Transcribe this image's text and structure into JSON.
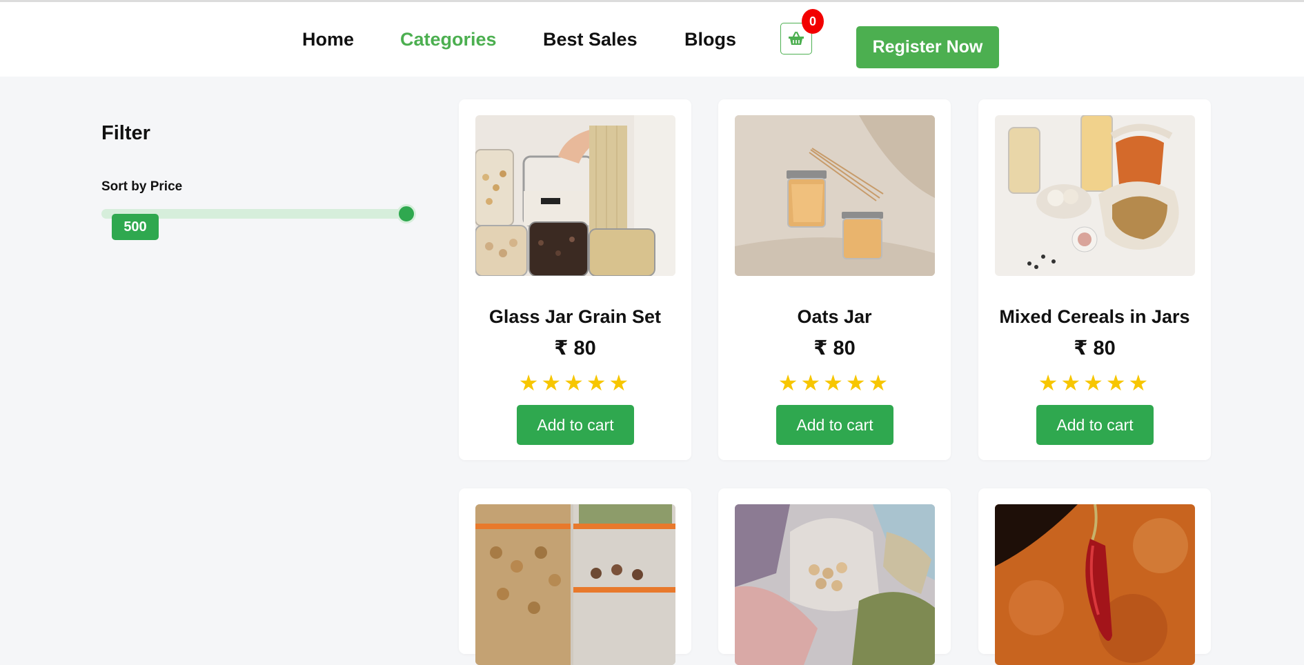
{
  "nav": {
    "links": [
      {
        "label": "Home",
        "active": false
      },
      {
        "label": "Categories",
        "active": true
      },
      {
        "label": "Best Sales",
        "active": false
      },
      {
        "label": "Blogs",
        "active": false
      }
    ],
    "cart_icon": "basket-icon",
    "cart_count": "0",
    "register_label": "Register Now"
  },
  "filter": {
    "title": "Filter",
    "sort_label": "Sort by Price",
    "slider_value": "500"
  },
  "products": [
    {
      "name": "Glass Jar Grain Set",
      "price": "₹ 80",
      "rating_stars": 5,
      "add_label": "Add to cart"
    },
    {
      "name": "Oats Jar",
      "price": "₹ 80",
      "rating_stars": 5,
      "add_label": "Add to cart"
    },
    {
      "name": "Mixed Cereals in Jars",
      "price": "₹ 80",
      "rating_stars": 5,
      "add_label": "Add to cart"
    },
    {
      "name": "",
      "price": "",
      "rating_stars": 0,
      "add_label": ""
    },
    {
      "name": "",
      "price": "",
      "rating_stars": 0,
      "add_label": ""
    },
    {
      "name": "",
      "price": "",
      "rating_stars": 0,
      "add_label": ""
    }
  ],
  "colors": {
    "accent": "#4caf50",
    "button": "#2fa84f",
    "badge": "#f20000",
    "star": "#f7c600"
  }
}
